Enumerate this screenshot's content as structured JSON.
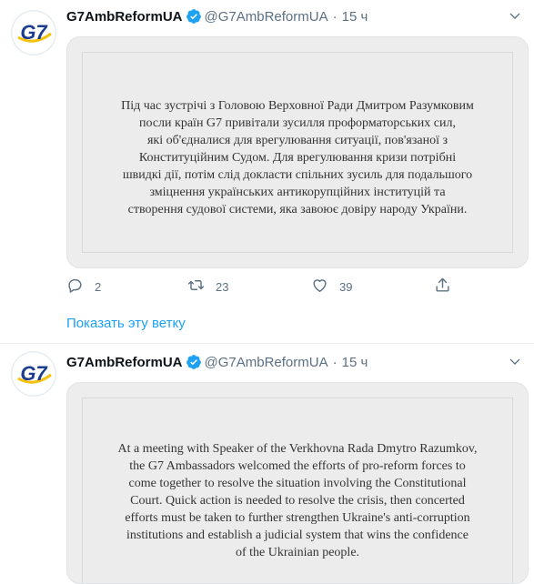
{
  "colors": {
    "accent": "#1da1f2",
    "secondary_text": "#5b7083",
    "verified": "#1da1f2",
    "logo_blue": "#1b3d8f",
    "logo_red": "#d8232a",
    "logo_yellow": "#f4c20d"
  },
  "tweets": [
    {
      "name": "G7AmbReformUA",
      "handle": "@G7AmbReformUA",
      "dot": "·",
      "time": "15 ч",
      "avatar_text": "G7",
      "card_text": "Під час зустрічі з Головою Верховної Ради Дмитром Разумковим\nпосли країн G7 привітали зусилля проформаторських сил,\nякі об'єдналися для врегулювання ситуації, пов'язаної з\nКонституційним Судом. Для врегулювання кризи потрібні\nшвидкі дії, потім слід докласти спільних зусиль для подальшого\nзміцнення українських антикорупційних інституцій та\nстворення судової системи, яка завоює довіру народу України.",
      "actions": {
        "reply": "2",
        "retweet": "23",
        "like": "39"
      }
    },
    {
      "name": "G7AmbReformUA",
      "handle": "@G7AmbReformUA",
      "dot": "·",
      "time": "15 ч",
      "avatar_text": "G7",
      "card_text": "At a meeting with Speaker of the Verkhovna Rada Dmytro Razumkov,\nthe G7 Ambassadors welcomed the efforts of pro-reform forces to\ncome together to resolve the situation involving the Constitutional\nCourt. Quick action is needed to resolve the crisis, then concerted\nefforts must be taken to further strengthen Ukraine's anti-corruption\ninstitutions and establish a judicial system that wins the confidence\nof the Ukrainian people."
    }
  ],
  "thread": {
    "show_thread_label": "Показать эту ветку"
  },
  "icons": {
    "verified": "verified-badge-icon",
    "more": "chevron-down-icon",
    "reply": "reply-icon",
    "retweet": "retweet-icon",
    "like": "heart-icon",
    "share": "share-icon"
  }
}
